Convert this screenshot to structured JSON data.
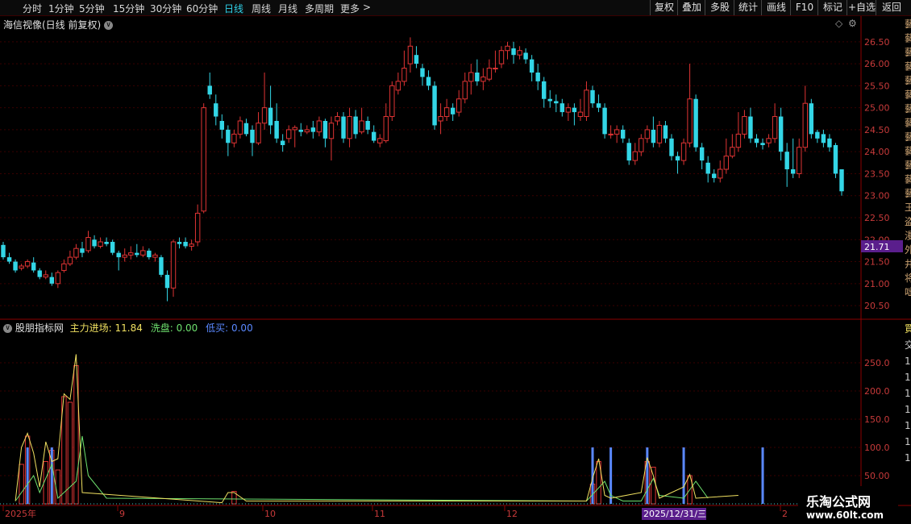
{
  "toolbar": {
    "periods": [
      "分时",
      "1分钟",
      "5分钟",
      "15分钟",
      "30分钟",
      "60分钟",
      "日线",
      "周线",
      "月线",
      "多周期",
      "更多"
    ],
    "active_period": "日线",
    "actions": [
      "复权",
      "叠加",
      "多股",
      "统计",
      "画线",
      "F10",
      "标记",
      "+自选",
      "返回"
    ]
  },
  "main_chart": {
    "title": "海信视像(日线 前复权)",
    "current_price_label": "21.71",
    "y_ticks": [
      "26.50",
      "26.00",
      "25.50",
      "25.00",
      "24.50",
      "24.00",
      "23.50",
      "23.00",
      "22.50",
      "22.00",
      "21.50",
      "21.00",
      "20.50"
    ]
  },
  "indicator": {
    "name": "股朋指标网",
    "main_label": "主力进场: 11.84",
    "wash_label": "洗盘: 0.00",
    "low_buy_label": "低买: 0.00",
    "y_ticks": [
      "250.0",
      "200.0",
      "150.0",
      "100.0",
      "50.00"
    ]
  },
  "x_axis": {
    "labels": [
      "2025年",
      "9",
      "10",
      "11",
      "12",
      "2"
    ],
    "cursor_date": "2025/12/31/三"
  },
  "right_strip_chars": [
    "藝",
    "藝",
    "藝",
    "藝",
    "藝",
    "藝",
    "藝",
    "藝",
    "藝",
    "藝",
    "藝",
    "藝",
    "藝",
    "王",
    "盗",
    "漫",
    "外",
    "井",
    "将",
    "咄"
  ],
  "indicator_strip_chars": [
    "買",
    "交",
    "1",
    "1",
    "1",
    "1",
    "1",
    "1",
    "1"
  ],
  "watermark": {
    "line1": "乐淘公式网",
    "line2": "www.60lt.com"
  },
  "colors": {
    "up": "#e03434",
    "down": "#33d6e6",
    "bg": "#000000",
    "grid": "#4a0000",
    "main_line": "#f0e060",
    "wash_line": "#6ee06e",
    "low_buy": "#5a88ff",
    "price_tag_bg": "#5a1e8c"
  },
  "chart_data": {
    "type": "candlestick",
    "y_range": [
      20.3,
      26.9
    ],
    "candles": [
      [
        21.88,
        21.6,
        21.95,
        21.55
      ],
      [
        21.6,
        21.5,
        21.7,
        21.45
      ],
      [
        21.5,
        21.3,
        21.55,
        21.25
      ],
      [
        21.35,
        21.4,
        21.45,
        21.3
      ],
      [
        21.4,
        21.5,
        21.55,
        21.35
      ],
      [
        21.48,
        21.3,
        21.6,
        21.25
      ],
      [
        21.3,
        21.15,
        21.35,
        21.1
      ],
      [
        21.15,
        21.2,
        21.3,
        21.1
      ],
      [
        21.15,
        21.0,
        21.25,
        20.95
      ],
      [
        21.0,
        21.25,
        21.3,
        20.9
      ],
      [
        21.3,
        21.45,
        21.55,
        21.25
      ],
      [
        21.45,
        21.6,
        21.75,
        21.4
      ],
      [
        21.6,
        21.8,
        21.9,
        21.55
      ],
      [
        21.8,
        21.7,
        21.95,
        21.6
      ],
      [
        21.75,
        22.05,
        22.2,
        21.7
      ],
      [
        22.0,
        21.85,
        22.1,
        21.8
      ],
      [
        21.85,
        21.95,
        22.05,
        21.8
      ],
      [
        21.95,
        21.9,
        22.05,
        21.85
      ],
      [
        21.95,
        21.7,
        22.0,
        21.65
      ],
      [
        21.7,
        21.6,
        21.75,
        21.3
      ],
      [
        21.6,
        21.65,
        21.8,
        21.5
      ],
      [
        21.65,
        21.7,
        21.85,
        21.55
      ],
      [
        21.7,
        21.65,
        21.9,
        21.6
      ],
      [
        21.65,
        21.75,
        21.85,
        21.6
      ],
      [
        21.75,
        21.6,
        21.8,
        21.55
      ],
      [
        21.6,
        21.65,
        21.7,
        21.5
      ],
      [
        21.6,
        21.2,
        21.65,
        21.15
      ],
      [
        21.2,
        20.9,
        21.3,
        20.6
      ],
      [
        20.9,
        21.95,
        22.0,
        20.7
      ],
      [
        21.95,
        21.9,
        22.05,
        21.8
      ],
      [
        21.95,
        21.85,
        22.05,
        21.8
      ],
      [
        21.85,
        21.9,
        22.0,
        21.75
      ],
      [
        21.95,
        22.6,
        22.8,
        21.85
      ],
      [
        22.65,
        25.0,
        25.1,
        22.6
      ],
      [
        25.5,
        25.3,
        25.8,
        25.2
      ],
      [
        25.1,
        24.8,
        25.3,
        24.6
      ],
      [
        24.7,
        24.5,
        24.85,
        24.3
      ],
      [
        24.5,
        24.2,
        24.6,
        23.9
      ],
      [
        24.2,
        24.4,
        24.5,
        24.1
      ],
      [
        24.4,
        24.7,
        24.8,
        24.3
      ],
      [
        24.65,
        24.4,
        24.75,
        24.35
      ],
      [
        24.5,
        24.2,
        24.6,
        23.9
      ],
      [
        24.2,
        24.65,
        24.9,
        24.15
      ],
      [
        24.65,
        25.0,
        25.8,
        24.5
      ],
      [
        25.0,
        24.6,
        25.5,
        24.4
      ],
      [
        24.7,
        24.3,
        25.1,
        24.2
      ],
      [
        24.25,
        24.15,
        24.4,
        24.0
      ],
      [
        24.3,
        24.5,
        24.6,
        24.2
      ],
      [
        24.5,
        24.55,
        24.6,
        24.1
      ],
      [
        24.5,
        24.45,
        24.65,
        24.35
      ],
      [
        24.45,
        24.5,
        24.6,
        24.4
      ],
      [
        24.55,
        24.45,
        24.7,
        24.3
      ],
      [
        24.45,
        24.7,
        24.8,
        24.35
      ],
      [
        24.7,
        24.3,
        24.75,
        24.1
      ],
      [
        24.3,
        24.65,
        24.8,
        23.8
      ],
      [
        24.7,
        24.8,
        24.9,
        24.6
      ],
      [
        24.8,
        24.3,
        24.9,
        24.2
      ],
      [
        24.3,
        24.8,
        25.0,
        24.1
      ],
      [
        24.8,
        24.4,
        24.95,
        24.3
      ],
      [
        24.45,
        24.7,
        25.0,
        24.4
      ],
      [
        24.7,
        24.5,
        24.8,
        24.4
      ],
      [
        24.45,
        24.25,
        24.6,
        24.2
      ],
      [
        24.2,
        24.3,
        24.4,
        24.1
      ],
      [
        24.25,
        24.8,
        25.1,
        24.2
      ],
      [
        24.8,
        25.5,
        25.6,
        24.7
      ],
      [
        25.4,
        25.6,
        25.8,
        25.3
      ],
      [
        25.6,
        25.9,
        26.3,
        25.5
      ],
      [
        26.0,
        26.4,
        26.6,
        25.8
      ],
      [
        26.2,
        26.0,
        26.4,
        25.9
      ],
      [
        25.9,
        25.7,
        26.0,
        25.5
      ],
      [
        25.7,
        25.5,
        25.85,
        25.4
      ],
      [
        25.5,
        24.6,
        25.6,
        24.5
      ],
      [
        24.7,
        24.8,
        25.1,
        24.4
      ],
      [
        24.8,
        25.0,
        25.2,
        24.7
      ],
      [
        25.0,
        24.85,
        25.1,
        24.7
      ],
      [
        24.9,
        25.2,
        25.4,
        24.8
      ],
      [
        25.2,
        25.6,
        25.8,
        25.1
      ],
      [
        25.6,
        25.8,
        26.0,
        25.3
      ],
      [
        25.8,
        25.6,
        26.1,
        25.5
      ],
      [
        25.6,
        25.7,
        25.9,
        25.4
      ],
      [
        25.65,
        25.9,
        26.1,
        25.6
      ],
      [
        25.9,
        25.9,
        26.3,
        25.8
      ],
      [
        26.0,
        26.3,
        26.4,
        25.9
      ],
      [
        26.3,
        26.4,
        26.5,
        26.1
      ],
      [
        26.35,
        26.2,
        26.5,
        26.0
      ],
      [
        26.2,
        26.3,
        26.4,
        26.1
      ],
      [
        26.25,
        26.1,
        26.35,
        26.0
      ],
      [
        26.1,
        25.8,
        26.2,
        25.6
      ],
      [
        25.8,
        25.6,
        26.0,
        25.4
      ],
      [
        25.6,
        25.2,
        25.7,
        25.0
      ],
      [
        25.2,
        25.15,
        25.4,
        25.0
      ],
      [
        25.15,
        25.1,
        25.3,
        24.9
      ],
      [
        25.1,
        24.9,
        25.2,
        24.8
      ],
      [
        24.9,
        25.0,
        25.1,
        24.7
      ],
      [
        25.0,
        24.9,
        25.1,
        24.6
      ],
      [
        24.8,
        24.9,
        25.2,
        24.7
      ],
      [
        24.8,
        25.4,
        25.6,
        24.7
      ],
      [
        25.4,
        25.1,
        25.5,
        25.0
      ],
      [
        25.1,
        25.0,
        25.3,
        24.9
      ],
      [
        25.0,
        24.4,
        25.1,
        24.3
      ],
      [
        24.4,
        24.4,
        24.6,
        24.3
      ],
      [
        24.4,
        24.5,
        24.6,
        24.2
      ],
      [
        24.5,
        24.3,
        24.6,
        24.2
      ],
      [
        24.2,
        23.8,
        24.3,
        23.7
      ],
      [
        23.8,
        24.0,
        24.2,
        23.7
      ],
      [
        24.0,
        24.3,
        24.4,
        23.9
      ],
      [
        24.3,
        24.5,
        24.6,
        24.2
      ],
      [
        24.5,
        24.2,
        24.8,
        24.1
      ],
      [
        24.2,
        24.6,
        24.7,
        24.1
      ],
      [
        24.6,
        24.3,
        24.7,
        24.2
      ],
      [
        24.3,
        23.9,
        24.4,
        23.8
      ],
      [
        23.9,
        23.8,
        24.0,
        23.5
      ],
      [
        23.8,
        24.2,
        24.3,
        23.7
      ],
      [
        24.2,
        25.2,
        26.0,
        24.1
      ],
      [
        25.2,
        24.1,
        25.3,
        24.0
      ],
      [
        24.1,
        23.8,
        24.2,
        23.6
      ],
      [
        23.75,
        23.5,
        23.9,
        23.3
      ],
      [
        23.5,
        23.4,
        23.6,
        23.3
      ],
      [
        23.4,
        23.6,
        23.8,
        23.3
      ],
      [
        23.6,
        23.9,
        24.3,
        23.5
      ],
      [
        23.9,
        24.1,
        24.4,
        23.85
      ],
      [
        24.1,
        24.4,
        24.9,
        24.0
      ],
      [
        24.4,
        24.8,
        24.95,
        24.3
      ],
      [
        24.8,
        24.3,
        25.0,
        24.2
      ],
      [
        24.3,
        24.2,
        24.4,
        24.1
      ],
      [
        24.2,
        24.15,
        24.3,
        24.05
      ],
      [
        24.2,
        24.3,
        24.4,
        24.1
      ],
      [
        24.3,
        24.8,
        25.1,
        24.2
      ],
      [
        24.8,
        24.0,
        25.0,
        23.8
      ],
      [
        24.0,
        23.6,
        24.2,
        23.2
      ],
      [
        23.6,
        23.5,
        24.3,
        23.4
      ],
      [
        23.5,
        24.1,
        24.3,
        23.4
      ],
      [
        24.1,
        25.1,
        25.5,
        24.0
      ],
      [
        25.1,
        24.4,
        25.2,
        24.3
      ],
      [
        24.45,
        24.3,
        24.5,
        24.2
      ],
      [
        24.4,
        24.2,
        24.5,
        24.1
      ],
      [
        24.3,
        24.1,
        24.4,
        24.0
      ],
      [
        24.15,
        23.5,
        24.2,
        23.4
      ],
      [
        23.6,
        23.1,
        23.6,
        23.0
      ]
    ],
    "indicator_bars": [
      [
        3,
        70
      ],
      [
        4,
        120
      ],
      [
        7,
        75
      ],
      [
        8,
        95
      ],
      [
        9,
        60
      ],
      [
        10,
        190
      ],
      [
        11,
        180
      ],
      [
        12,
        245
      ],
      [
        38,
        22
      ],
      [
        97,
        35
      ],
      [
        98,
        75
      ],
      [
        106,
        75
      ],
      [
        107,
        65
      ],
      [
        113,
        50
      ],
      [
        121,
        0
      ]
    ],
    "indicator_main_line": [
      [
        2,
        5
      ],
      [
        3,
        100
      ],
      [
        4,
        125
      ],
      [
        5,
        90
      ],
      [
        6,
        30
      ],
      [
        7,
        110
      ],
      [
        8,
        75
      ],
      [
        9,
        80
      ],
      [
        10,
        195
      ],
      [
        11,
        185
      ],
      [
        12,
        265
      ],
      [
        13,
        20
      ],
      [
        36,
        2
      ],
      [
        37,
        20
      ],
      [
        38,
        20
      ],
      [
        40,
        5
      ],
      [
        96,
        5
      ],
      [
        97,
        45
      ],
      [
        98,
        80
      ],
      [
        99,
        15
      ],
      [
        100,
        10
      ],
      [
        105,
        20
      ],
      [
        106,
        82
      ],
      [
        107,
        50
      ],
      [
        108,
        10
      ],
      [
        112,
        30
      ],
      [
        113,
        52
      ],
      [
        114,
        10
      ],
      [
        121,
        15
      ]
    ],
    "indicator_wash_line": [
      [
        2,
        5
      ],
      [
        5,
        50
      ],
      [
        6,
        20
      ],
      [
        8,
        70
      ],
      [
        9,
        10
      ],
      [
        12,
        40
      ],
      [
        13,
        120
      ],
      [
        14,
        50
      ],
      [
        17,
        10
      ],
      [
        96,
        5
      ],
      [
        99,
        40
      ],
      [
        100,
        15
      ],
      [
        102,
        5
      ],
      [
        105,
        5
      ],
      [
        107,
        45
      ],
      [
        108,
        15
      ],
      [
        112,
        10
      ],
      [
        114,
        40
      ],
      [
        116,
        10
      ]
    ],
    "indicator_low_buy": [
      4,
      8,
      97,
      100,
      106,
      112,
      125
    ],
    "indicator_low_buy_value": 100,
    "indicator_y_range": [
      0,
      300
    ]
  }
}
